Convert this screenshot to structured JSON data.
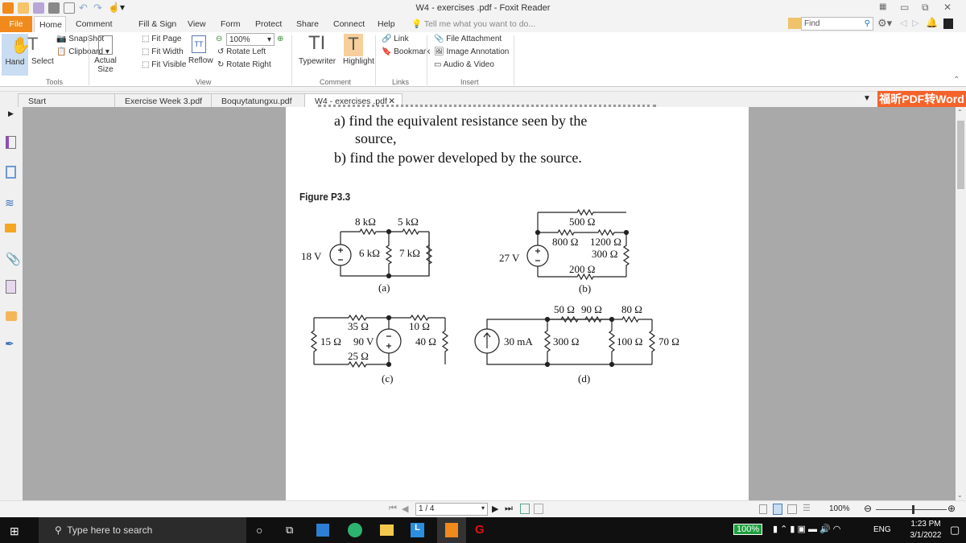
{
  "window": {
    "title": "W4 - exercises .pdf - Foxit Reader"
  },
  "menu_tabs": [
    "File",
    "Home",
    "Comment",
    "Fill & Sign",
    "View",
    "Form",
    "Protect",
    "Share",
    "Connect",
    "Help"
  ],
  "tell_me": "Tell me what you want to do...",
  "find_placeholder": "Find",
  "ribbon": {
    "hand": "Hand",
    "select": "Select",
    "snapshot": "SnapShot",
    "clipboard": "Clipboard",
    "tools_group": "Tools",
    "actual_size": "Actual Size",
    "fit_page": "Fit Page",
    "fit_width": "Fit Width",
    "fit_visible": "Fit Visible",
    "reflow": "Reflow",
    "zoom_value": "100%",
    "rotate_left": "Rotate Left",
    "rotate_right": "Rotate Right",
    "view_group": "View",
    "typewriter": "Typewriter",
    "highlight": "Highlight",
    "comment_group": "Comment",
    "link": "Link",
    "bookmark": "Bookmark",
    "links_group": "Links",
    "file_attachment": "File Attachment",
    "image_annotation": "Image Annotation",
    "audio_video": "Audio & Video",
    "insert_group": "Insert"
  },
  "doc_tabs": [
    "Start",
    "Exercise Week 3.pdf",
    "Boquytatungxu.pdf",
    "W4 - exercises .pdf"
  ],
  "promo": "福昕PDF转Word",
  "page": {
    "line1": "a)  find  the  equivalent  resistance  seen  by  the",
    "line2": "source,",
    "line3": "b)  find the power developed by the source.",
    "figure_title": "Figure P3.3",
    "a": {
      "r1": "8 kΩ",
      "r2": "5 kΩ",
      "src": "18 V",
      "r3": "6 kΩ",
      "r4": "7 kΩ",
      "cap": "(a)"
    },
    "b": {
      "r_top": "500 Ω",
      "r1": "800 Ω",
      "r2": "1200 Ω",
      "r3": "300 Ω",
      "r4": "200 Ω",
      "src": "27 V",
      "cap": "(b)"
    },
    "c": {
      "r1": "35 Ω",
      "r2": "10 Ω",
      "r3": "15 Ω",
      "src": "90 V",
      "r4": "40 Ω",
      "r5": "25 Ω",
      "cap": "(c)"
    },
    "d": {
      "r1": "50 Ω",
      "r2": "90 Ω",
      "r3": "80 Ω",
      "src": "30 mA",
      "r4": "300 Ω",
      "r5": "100 Ω",
      "r6": "70 Ω",
      "cap": "(d)"
    }
  },
  "status": {
    "page": "1 / 4",
    "zoom": "100%"
  },
  "taskbar": {
    "search": "Type here to search",
    "battery": "100%",
    "lang": "ENG",
    "time": "1:23 PM",
    "date": "3/1/2022"
  },
  "colors": {
    "accent": "#f08a1c",
    "promo": "#f4632a",
    "highlight": "#f6cf9b"
  }
}
